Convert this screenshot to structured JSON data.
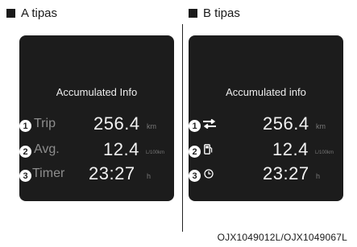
{
  "sections": {
    "a": {
      "label": "A tipas",
      "title": "Accumulated Info",
      "rows": [
        {
          "num": "1",
          "label": "Trip",
          "value": "256.4",
          "unit": "km"
        },
        {
          "num": "2",
          "label": "Avg.",
          "value": "12.4",
          "unit": "L/100km"
        },
        {
          "num": "3",
          "label": "Timer",
          "value": "23:27",
          "unit": "h"
        }
      ]
    },
    "b": {
      "label": "B tipas",
      "title": "Accumulated info",
      "rows": [
        {
          "num": "1",
          "icon": "distance-arrows-icon",
          "value": "256.4",
          "unit": "km"
        },
        {
          "num": "2",
          "icon": "fuel-pump-icon",
          "value": "12.4",
          "unit": "L/100km"
        },
        {
          "num": "3",
          "icon": "clock-icon",
          "value": "23:27",
          "unit": "h"
        }
      ]
    }
  },
  "footer": "OJX1049012L/OJX1049067L"
}
